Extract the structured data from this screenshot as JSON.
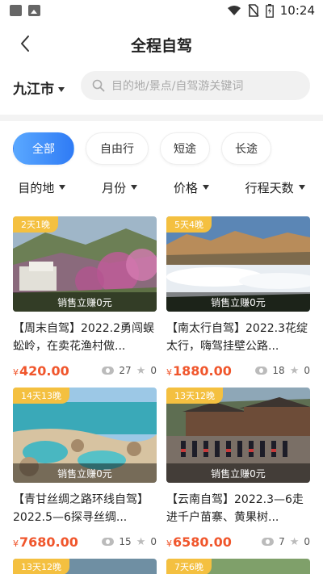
{
  "status_bar": {
    "time": "10:24"
  },
  "header": {
    "title": "全程自驾"
  },
  "location": {
    "city": "九江市"
  },
  "search": {
    "placeholder": "目的地/景点/自驾游关键词"
  },
  "tabs": [
    {
      "label": "全部",
      "active": true
    },
    {
      "label": "自由行",
      "active": false
    },
    {
      "label": "短途",
      "active": false
    },
    {
      "label": "长途",
      "active": false
    }
  ],
  "filters": [
    {
      "label": "目的地"
    },
    {
      "label": "月份"
    },
    {
      "label": "价格"
    },
    {
      "label": "行程天数"
    }
  ],
  "cards": [
    {
      "badge": "2天1晚",
      "sale_label": "销售立赚0元",
      "title": "【周末自驾】2022.2勇闯蜈蚣岭，在卖花渔村做...",
      "price_symbol": "¥",
      "price": "420.00",
      "views": "27",
      "favorites": "0"
    },
    {
      "badge": "5天4晚",
      "sale_label": "销售立赚0元",
      "title": "【南太行自驾】2022.3花绽太行，嗨驾挂壁公路...",
      "price_symbol": "¥",
      "price": "1880.00",
      "views": "18",
      "favorites": "0"
    },
    {
      "badge": "14天13晚",
      "sale_label": "销售立赚0元",
      "title": "【青甘丝绸之路环线自驾】2022.5—6探寻丝绸...",
      "price_symbol": "¥",
      "price": "7680.00",
      "views": "15",
      "favorites": "0"
    },
    {
      "badge": "13天12晚",
      "sale_label": "销售立赚0元",
      "title": "【云南自驾】2022.3—6走进千户苗寨、黄果树...",
      "price_symbol": "¥",
      "price": "6580.00",
      "views": "7",
      "favorites": "0"
    },
    {
      "badge": "13天12晚"
    },
    {
      "badge": "7天6晚"
    }
  ],
  "colors": {
    "accent": "#2f7bf5",
    "price": "#f0562c",
    "badge": "#f4c040"
  }
}
